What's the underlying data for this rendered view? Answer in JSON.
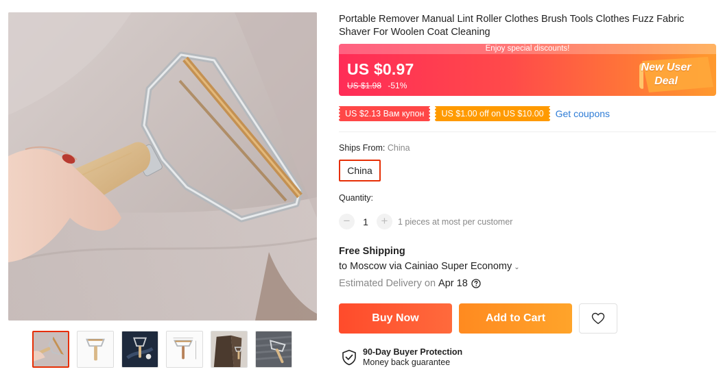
{
  "product": {
    "title": "Portable Remover Manual Lint Roller Clothes Brush Tools Clothes Fuzz Fabric Shaver For Woolen Coat Cleaning"
  },
  "gallery": {
    "main_image": "lint-remover-on-coat-photo",
    "thumbnails": [
      {
        "name": "lint-remover-on-coat",
        "selected": true
      },
      {
        "name": "lint-remover-white-background",
        "selected": false
      },
      {
        "name": "lint-remover-on-dark-fabric",
        "selected": false
      },
      {
        "name": "lint-remover-dimensions",
        "selected": false
      },
      {
        "name": "lint-remover-on-brown-coat",
        "selected": false
      },
      {
        "name": "lint-remover-on-grey-knit",
        "selected": false
      }
    ]
  },
  "price": {
    "banner_text": "Enjoy special discounts!",
    "current": "US $0.97",
    "original": "US $1.98",
    "discount": "-51%",
    "badge": "New User Deal"
  },
  "coupons": {
    "items": [
      "US $2.13 Вам купон",
      "US $1.00 off on US $10.00"
    ],
    "get_label": "Get coupons"
  },
  "shipping_origin": {
    "label": "Ships From:",
    "value": "China",
    "option": "China"
  },
  "quantity": {
    "label": "Quantity:",
    "minus": "−",
    "value": "1",
    "plus": "+",
    "note": "1 pieces at most per customer"
  },
  "shipping": {
    "title": "Free Shipping",
    "route": "to Moscow via Cainiao Super Economy",
    "chevron": "⌄",
    "delivery_label": "Estimated Delivery on",
    "delivery_date": "Apr 18"
  },
  "actions": {
    "buy_now": "Buy Now",
    "add_to_cart": "Add to Cart",
    "wishlist_icon": "heart-icon"
  },
  "protection": {
    "title": "90-Day Buyer Protection",
    "subtitle": "Money back guarantee"
  },
  "colors": {
    "accent_red": "#e62e04",
    "buy_orange_red": "#ff4b2b",
    "cart_orange": "#ff9a20",
    "link_blue": "#2e7cd6"
  }
}
